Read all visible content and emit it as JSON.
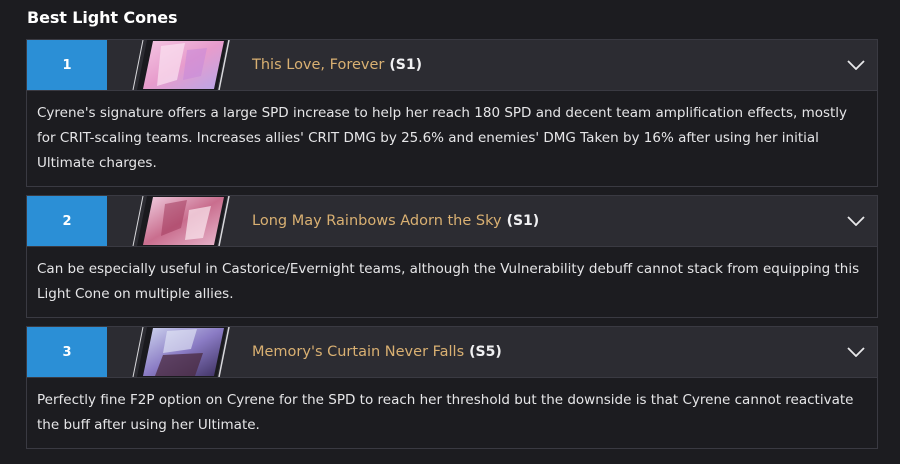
{
  "section": {
    "title": "Best Light Cones"
  },
  "cones": [
    {
      "rank": "1",
      "name": "This Love, Forever",
      "superimposition": "(S1)",
      "description": "Cyrene's signature offers a large SPD increase to help her reach 180 SPD and decent team amplification effects, mostly for CRIT-scaling teams. Increases allies' CRIT DMG by 25.6% and enemies' DMG Taken by 16% after using her initial Ultimate charges.",
      "icon": "chevron-down-icon"
    },
    {
      "rank": "2",
      "name": "Long May Rainbows Adorn the Sky",
      "superimposition": "(S1)",
      "description": "Can be especially useful in Castorice/Evernight teams, although the Vulnerability debuff cannot stack from equipping this Light Cone on multiple allies.",
      "icon": "chevron-down-icon"
    },
    {
      "rank": "3",
      "name": "Memory's Curtain Never Falls",
      "superimposition": "(S5)",
      "description": "Perfectly fine F2P option on Cyrene for the SPD to reach her threshold but the downside is that Cyrene cannot reactivate the buff after using her Ultimate.",
      "icon": "chevron-down-icon"
    }
  ],
  "colors": {
    "rank_bg": "#2b8fd6",
    "cone_name": "#d9b072",
    "header_bg": "#2c2c32",
    "page_bg": "#1c1c20"
  }
}
